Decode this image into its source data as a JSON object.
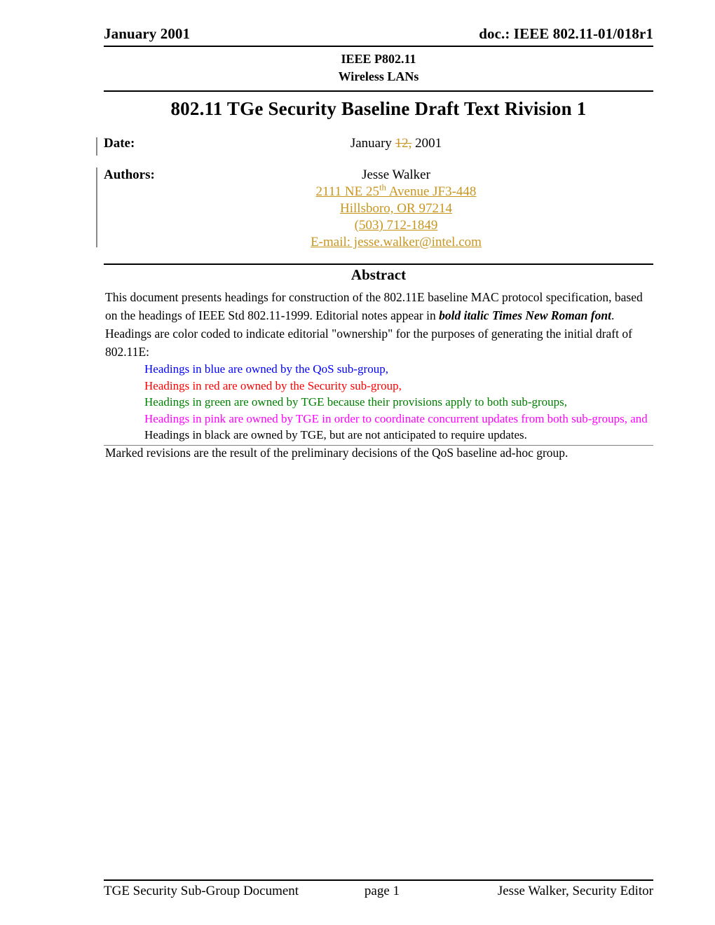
{
  "header": {
    "date": "January 2001",
    "doc_number": "doc.: IEEE 802.11-01/018r1"
  },
  "masthead": {
    "line1": "IEEE P802.11",
    "line2": "Wireless LANs"
  },
  "title": "802.11 TGe Security Baseline Draft Text Rivision 1",
  "meta": {
    "date_label": "Date:",
    "date_prefix": "January ",
    "date_deleted": "12,",
    "date_suffix": " 2001",
    "authors_label": "Authors:",
    "author_name": "Jesse Walker",
    "address_line1_pre": "2111 NE 25",
    "address_line1_sup": "th",
    "address_line1_post": " Avenue JF3-448",
    "address_line2": "Hillsboro, OR  97214",
    "phone": "(503) 712-1849",
    "email": "E-mail: jesse.walker@intel.com"
  },
  "abstract": {
    "heading": "Abstract",
    "para1_a": "This document presents headings for construction of the 802.11E baseline MAC protocol specification, based on the headings of IEEE Std 802.11-1999. Editorial notes appear in ",
    "para1_bold_italic": "bold italic Times New Roman font",
    "para1_b": ".  Headings are color coded to indicate editorial \"ownership\" for the purposes of generating the initial draft of 802.11E:",
    "color_items": [
      {
        "text": "Headings in blue are owned by the QoS sub-group,",
        "color": "#0000ff"
      },
      {
        "text": "Headings in red are owned by the Security sub-group,",
        "color": "#ff0000"
      },
      {
        "text": "Headings in green are owned by TGE because their provisions apply to both sub-groups,",
        "color": "#008000"
      },
      {
        "text": "Headings in pink are owned by TGE in order to coordinate concurrent updates from both sub-groups, and",
        "color": "#ff00ff"
      },
      {
        "text": "Headings in black are owned by TGE, but are not anticipated to require updates.",
        "color": "#000000"
      }
    ],
    "para2": "Marked revisions are the result of the preliminary decisions of the QoS baseline ad-hoc group."
  },
  "footer": {
    "left": "TGE Security Sub-Group Document",
    "center": "page 1",
    "right": "Jesse Walker, Security Editor"
  },
  "colors": {
    "revision_gold": "#c8961e",
    "change_bar": "#8a8a8a",
    "rule_black": "#000000",
    "rule_gray": "#808080"
  }
}
